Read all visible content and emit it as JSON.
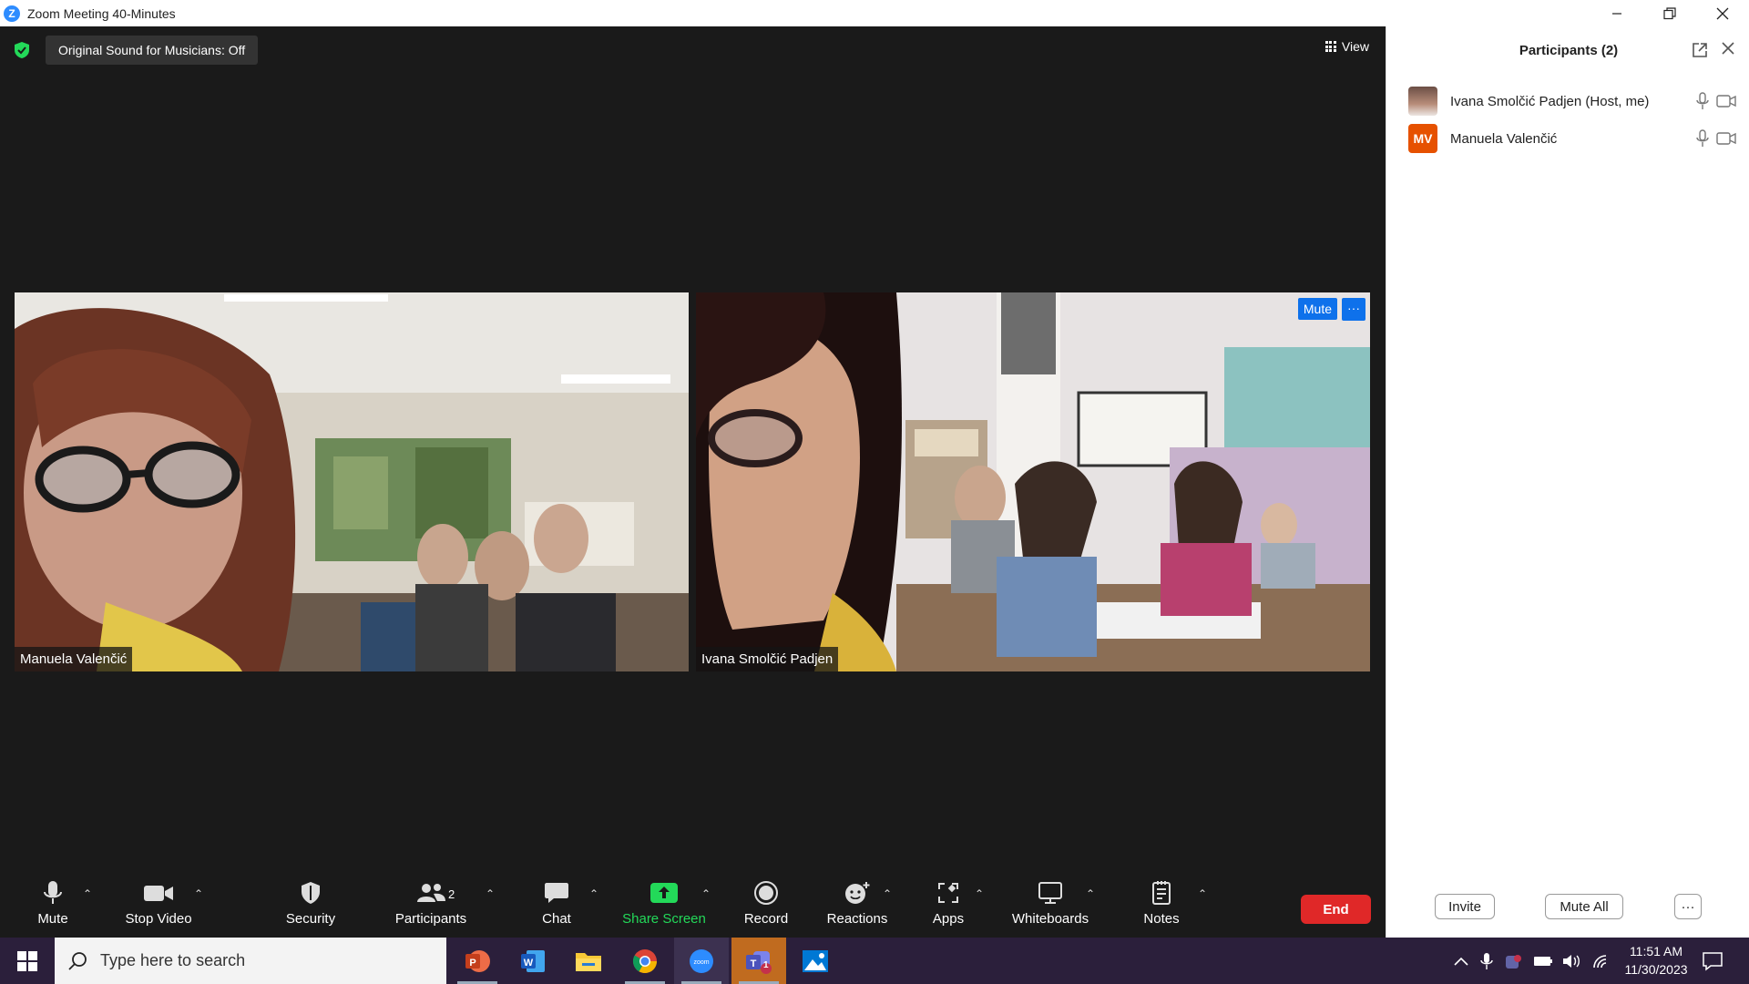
{
  "window": {
    "title": "Zoom Meeting 40-Minutes",
    "controls": [
      "minimize",
      "restore",
      "close"
    ]
  },
  "meeting": {
    "sound_pill": "Original Sound for Musicians: Off",
    "view_label": "View",
    "tiles": [
      {
        "name": "Manuela Valenčić"
      },
      {
        "name": "Ivana Smolčić Padjen",
        "mute_label": "Mute",
        "more_label": "···"
      }
    ]
  },
  "toolbar": {
    "items": [
      {
        "label": "Mute",
        "icon": "microphone-icon"
      },
      {
        "label": "Stop Video",
        "icon": "video-camera-icon"
      },
      {
        "label": "Security",
        "icon": "shield-icon"
      },
      {
        "label": "Participants",
        "icon": "participants-icon",
        "count": "2"
      },
      {
        "label": "Chat",
        "icon": "chat-icon"
      },
      {
        "label": "Share Screen",
        "icon": "share-screen-icon"
      },
      {
        "label": "Record",
        "icon": "record-icon"
      },
      {
        "label": "Reactions",
        "icon": "reactions-icon"
      },
      {
        "label": "Apps",
        "icon": "apps-icon"
      },
      {
        "label": "Whiteboards",
        "icon": "whiteboard-icon"
      },
      {
        "label": "Notes",
        "icon": "notes-icon"
      }
    ],
    "end_label": "End"
  },
  "participants_panel": {
    "title": "Participants (2)",
    "participants": [
      {
        "name": "Ivana Smolčić Padjen (Host, me)",
        "avatar": "photo"
      },
      {
        "name": "Manuela Valenčić",
        "avatar_initials": "MV",
        "avatar_color": "#E65100"
      }
    ],
    "invite_label": "Invite",
    "mute_all_label": "Mute All",
    "more_label": "···"
  },
  "taskbar": {
    "search_placeholder": "Type here to search",
    "time": "11:51 AM",
    "date": "11/30/2023",
    "teams_badge": "1",
    "apps": [
      "powerpoint",
      "word",
      "file-explorer",
      "chrome",
      "zoom",
      "teams",
      "photos"
    ]
  },
  "colors": {
    "zoom_blue": "#2D8CFF",
    "end_red": "#E02828",
    "share_green": "#23D959",
    "taskbar": "#2b1f3b"
  }
}
